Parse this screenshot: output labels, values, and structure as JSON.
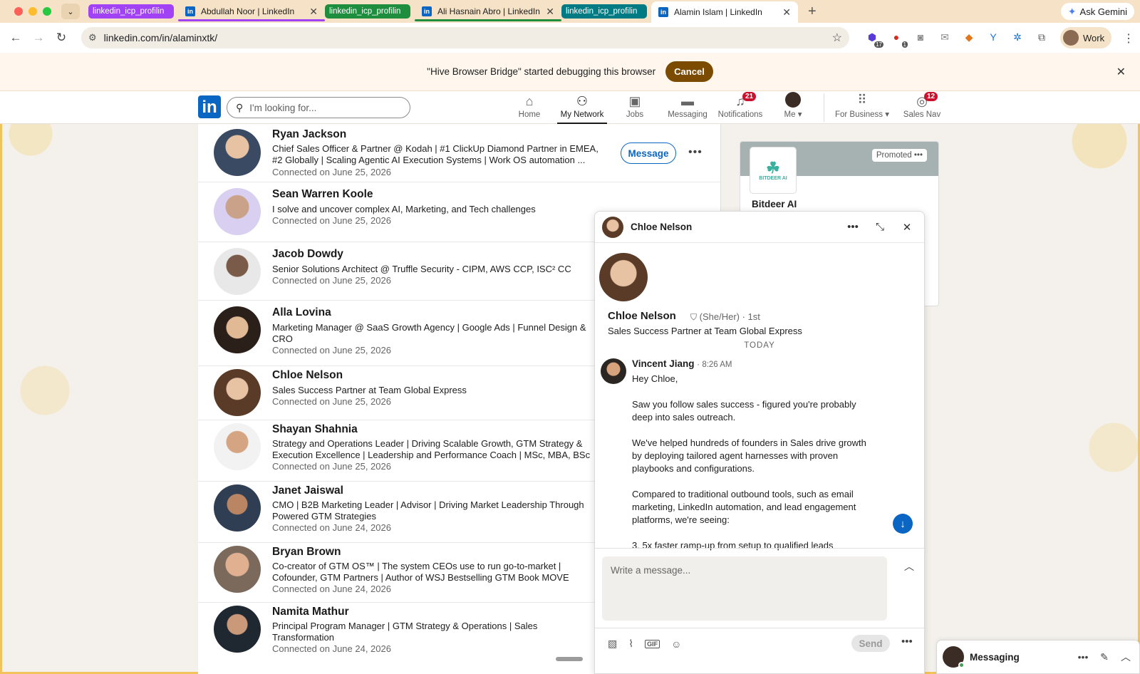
{
  "browser": {
    "tabs": [
      {
        "group": "linkedin_icp_profilin",
        "group_color": "#a142f4",
        "title": "Abdullah Noor | LinkedIn",
        "underline": "#a142f4"
      },
      {
        "group": "linkedin_icp_profilin",
        "group_color": "#1e8e3e",
        "title": "Ali Hasnain Abro | LinkedIn",
        "underline": "#1e8e3e"
      },
      {
        "group": "linkedin_icp_profilin",
        "group_color": "#007b83",
        "title": "Alamin Islam | LinkedIn",
        "underline": "#007b83"
      }
    ],
    "ask_gemini": "Ask Gemini",
    "url": "linkedin.com/in/alaminxtk/",
    "extensions_badge_1": "17",
    "extensions_badge_2": "1",
    "profile_chip": "Work"
  },
  "infobar": {
    "message": "\"Hive Browser Bridge\" started debugging this browser",
    "cancel": "Cancel"
  },
  "linkedin_nav": {
    "logo": "in",
    "search_placeholder": "I'm looking for...",
    "items": [
      {
        "label": "Home",
        "icon": "home-icon"
      },
      {
        "label": "My Network",
        "icon": "network-icon"
      },
      {
        "label": "Jobs",
        "icon": "briefcase-icon"
      },
      {
        "label": "Messaging",
        "icon": "chat-icon"
      },
      {
        "label": "Notifications",
        "icon": "bell-icon",
        "badge": "21"
      },
      {
        "label": "Me",
        "icon": "avatar"
      },
      {
        "label": "For Business",
        "icon": "grid-icon"
      },
      {
        "label": "Sales Nav",
        "icon": "compass-icon",
        "badge": "12"
      }
    ]
  },
  "connections": [
    {
      "name": "Ryan Jackson",
      "headline": "Chief Sales Officer & Partner @ Kodah | #1 ClickUp Diamond Partner in EMEA, #2 Globally | Scaling Agentic AI Execution Systems | Work OS automation ...",
      "connected": "Connected on June 25, 2026",
      "message_label": "Message"
    },
    {
      "name": "Sean Warren Koole",
      "headline": "I solve and uncover complex AI, Marketing, and Tech challenges",
      "connected": "Connected on June 25, 2026"
    },
    {
      "name": "Jacob Dowdy",
      "headline": "Senior Solutions Architect @ Truffle Security - CIPM, AWS CCP, ISC² CC",
      "connected": "Connected on June 25, 2026"
    },
    {
      "name": "Alla Lovina",
      "headline": "Marketing Manager @ SaaS Growth Agency | Google Ads | Funnel Design & CRO",
      "connected": "Connected on June 25, 2026"
    },
    {
      "name": "Chloe Nelson",
      "headline": "Sales Success Partner at Team Global Express",
      "connected": "Connected on June 25, 2026"
    },
    {
      "name": "Shayan Shahnia",
      "headline": "Strategy and Operations Leader | Driving Scalable Growth, GTM Strategy & Execution Excellence | Leadership and Performance Coach | MSc, MBA, BSc",
      "connected": "Connected on June 25, 2026"
    },
    {
      "name": "Janet Jaiswal",
      "headline": "CMO | B2B Marketing Leader | Advisor | Driving Market Leadership Through Powered GTM Strategies",
      "connected": "Connected on June 24, 2026"
    },
    {
      "name": "Bryan Brown",
      "headline": "Co-creator of GTM OS™ | The system CEOs use to run go-to-market | Cofounder, GTM Partners | Author of WSJ Bestselling GTM Book MOVE",
      "connected": "Connected on June 24, 2026"
    },
    {
      "name": "Namita Mathur",
      "headline": "Principal Program Manager  |  GTM Strategy & Operations  |  Sales Transformation",
      "connected": "Connected on June 24, 2026"
    }
  ],
  "promo": {
    "tag": "Promoted",
    "company": "Bitdeer AI",
    "logo_text": "BITDEER AI"
  },
  "chat": {
    "title": "Chloe Nelson",
    "profile_name": "Chloe Nelson",
    "profile_meta": "(She/Her) · 1st",
    "profile_headline": "Sales Success Partner at Team Global Express",
    "day_divider": "TODAY",
    "sender": "Vincent Jiang",
    "time": "· 8:26 AM",
    "message_paragraphs": [
      "Hey Chloe,",
      "Saw you follow sales success - figured you're probably deep into sales outreach.",
      "We've helped hundreds of founders in Sales drive growth by deploying tailored agent harnesses with proven playbooks and configurations.",
      "Compared to traditional outbound tools, such as email marketing, LinkedIn automation, and lead engagement platforms, we're seeing:",
      "3. 5x faster ramp-up from setup to qualified leads"
    ],
    "compose_placeholder": "Write a message...",
    "send_label": "Send"
  },
  "dock": {
    "title": "Messaging"
  },
  "colors": {
    "linkedin_blue": "#0a66c2",
    "badge_red": "#cb112d",
    "cancel_brown": "#7a4b00"
  }
}
